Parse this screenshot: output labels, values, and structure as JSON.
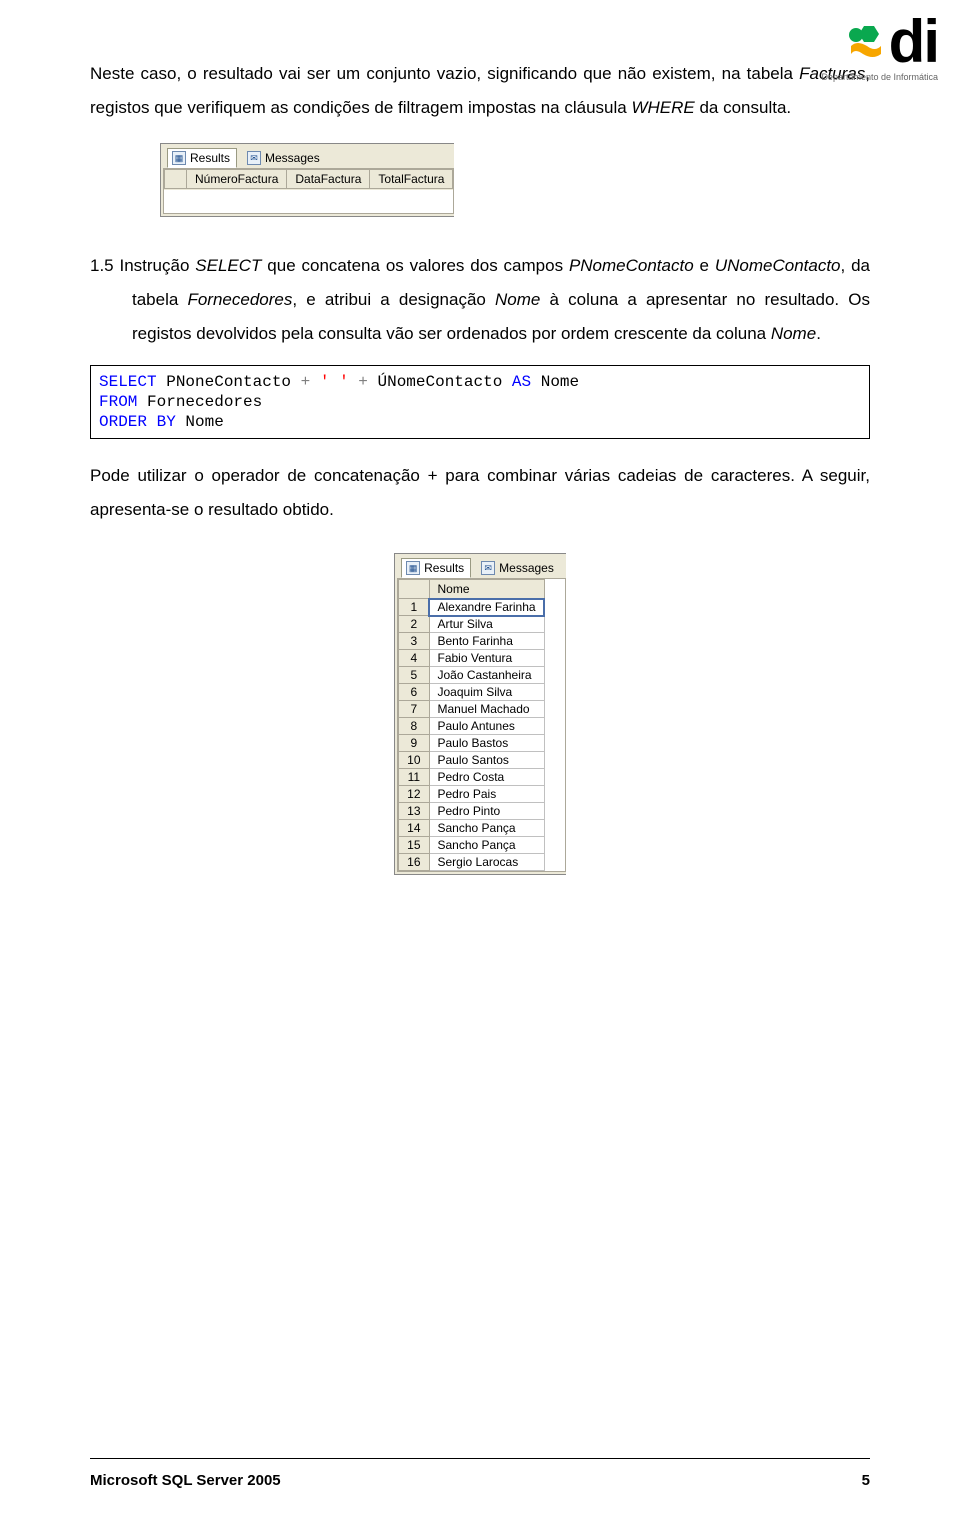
{
  "logo": {
    "text": "di",
    "subtitle": "Departamento de Informática"
  },
  "para1_runs": {
    "a": "Neste caso, o resultado vai ser um conjunto vazio, significando que não existem, na tabela ",
    "b": "Facturas",
    "c": ", registos que verifiquem as condições de filtragem impostas na cláusula ",
    "d": "WHERE",
    "e": " da consulta."
  },
  "screenshot1": {
    "tabs": {
      "results": "Results",
      "messages": "Messages"
    },
    "columns": [
      "NúmeroFactura",
      "DataFactura",
      "TotalFactura"
    ]
  },
  "numbered": {
    "num": "1.5 ",
    "runs": {
      "a": "Instrução ",
      "b": "SELECT",
      "c": " que concatena os valores dos campos ",
      "d": "PNomeContacto",
      "e": " e ",
      "f": "UNomeContacto",
      "g": ", da tabela ",
      "h": "Fornecedores",
      "i": ", e atribui a designação ",
      "j": "Nome",
      "k": " à coluna a apresentar no resultado. Os registos devolvidos pela consulta vão ser ordenados por ordem crescente da coluna ",
      "l": "Nome",
      "m": "."
    }
  },
  "code": {
    "t1": "SELECT",
    "t2": " PNoneContacto ",
    "t3": "+",
    "t4": " ",
    "t5": "' '",
    "t6": " ",
    "t7": "+",
    "t8": " ÚNomeContacto ",
    "t9": "AS",
    "t10": " Nome\n",
    "t11": "FROM",
    "t12": " Fornecedores\n",
    "t13": "ORDER",
    "t14": " ",
    "t15": "BY",
    "t16": " Nome"
  },
  "para2": "Pode utilizar o operador de concatenação + para combinar várias cadeias de caracteres. A seguir, apresenta-se o resultado obtido.",
  "screenshot2": {
    "tabs": {
      "results": "Results",
      "messages": "Messages"
    },
    "column": "Nome",
    "rows": [
      "Alexandre Farinha",
      "Artur Silva",
      "Bento Farinha",
      "Fabio Ventura",
      "João Castanheira",
      "Joaquim Silva",
      "Manuel Machado",
      "Paulo Antunes",
      "Paulo Bastos",
      "Paulo Santos",
      "Pedro Costa",
      "Pedro Pais",
      "Pedro Pinto",
      "Sancho Pança",
      "Sancho Pança",
      "Sergio Larocas"
    ]
  },
  "footer": {
    "left": "Microsoft SQL Server 2005",
    "right": "5"
  }
}
